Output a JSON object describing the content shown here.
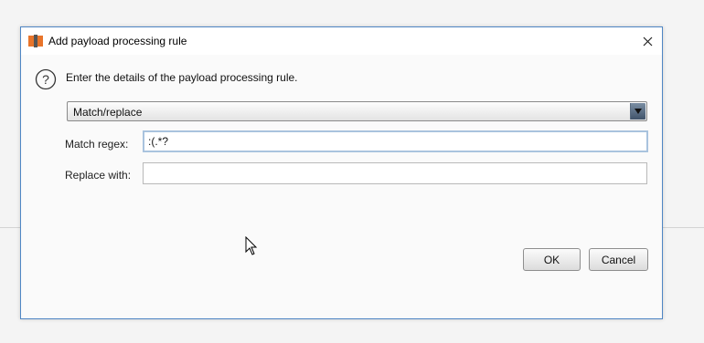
{
  "dialog": {
    "title": "Add payload processing rule",
    "instruction": "Enter the details of the payload processing rule.",
    "rule_type": {
      "selected": "Match/replace"
    },
    "match_regex": {
      "label": "Match regex:",
      "value": ":(.*?"
    },
    "replace_with": {
      "label": "Replace with:",
      "value": ""
    },
    "ok_label": "OK",
    "cancel_label": "Cancel"
  },
  "colors": {
    "dialog_border": "#4f86c4",
    "focus_border": "#a9c3de",
    "app_icon_orange": "#e8742a"
  },
  "icons": {
    "app": "burp-app-icon",
    "help": "question-icon",
    "close": "close-icon",
    "dropdown": "chevron-down-icon",
    "pointer": "mouse-cursor-icon"
  }
}
